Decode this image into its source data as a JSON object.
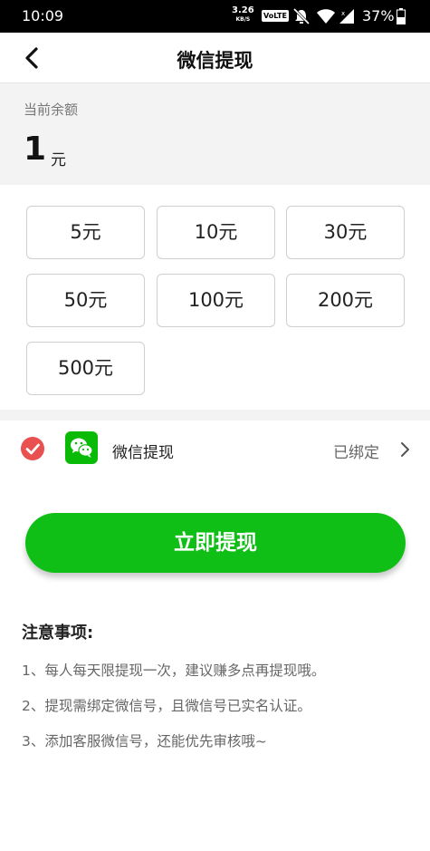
{
  "status_bar": {
    "time": "10:09",
    "speed_value": "3.26",
    "speed_unit": "KB/S",
    "volte": "VoLTE",
    "battery_percent": "37%"
  },
  "header": {
    "title": "微信提现"
  },
  "balance": {
    "label": "当前余额",
    "value": "1",
    "unit": "元"
  },
  "amount_options": [
    "5元",
    "10元",
    "30元",
    "50元",
    "100元",
    "200元",
    "500元"
  ],
  "payment": {
    "label": "微信提现",
    "status": "已绑定"
  },
  "withdraw_button": "立即提现",
  "notes": {
    "title": "注意事项:",
    "items": [
      "1、每人每天限提现一次，建议赚多点再提现哦。",
      "2、提现需绑定微信号，且微信号已实名认证。",
      "3、添加客服微信号，还能优先审核哦~"
    ]
  },
  "colors": {
    "accent_green": "#0fbf16",
    "wechat_green": "#09bb07",
    "check_red": "#e8514f"
  }
}
